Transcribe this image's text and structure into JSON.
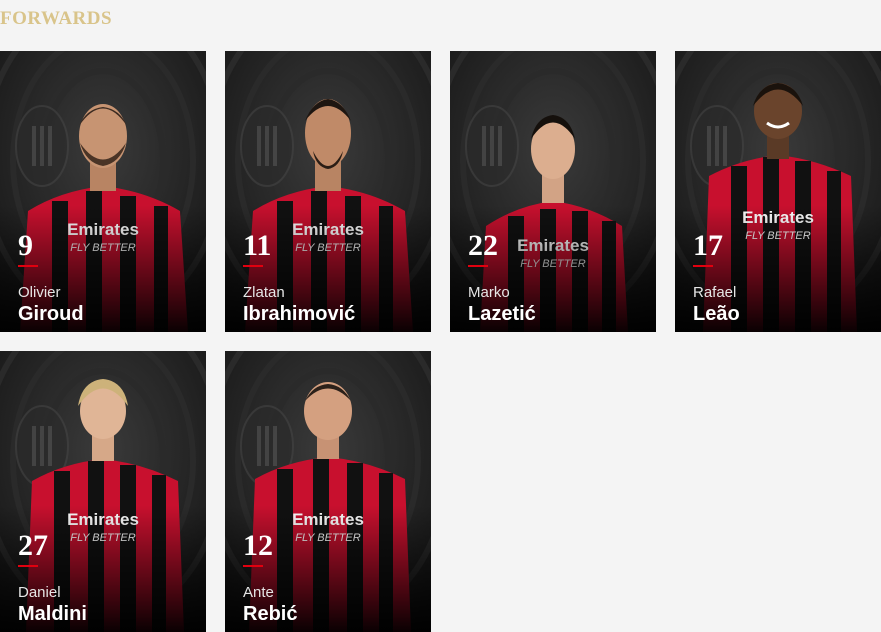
{
  "section": {
    "title": "FORWARDS"
  },
  "colors": {
    "accent_red": "#e1000f",
    "title_gold": "#d9c48a",
    "jersey_red": "#c8102e",
    "jersey_black": "#111111"
  },
  "players": [
    {
      "number": "9",
      "first_name": "Olivier",
      "last_name": "Giroud",
      "jersey_sponsor": "Emirates",
      "jersey_tagline": "FLY BETTER"
    },
    {
      "number": "11",
      "first_name": "Zlatan",
      "last_name": "Ibrahimović",
      "jersey_sponsor": "Emirates",
      "jersey_tagline": "FLY BETTER"
    },
    {
      "number": "22",
      "first_name": "Marko",
      "last_name": "Lazetić",
      "jersey_sponsor": "Emirates",
      "jersey_tagline": "FLY BETTER"
    },
    {
      "number": "17",
      "first_name": "Rafael",
      "last_name": "Leão",
      "jersey_sponsor": "Emirates",
      "jersey_tagline": "FLY BETTER"
    },
    {
      "number": "27",
      "first_name": "Daniel",
      "last_name": "Maldini",
      "jersey_sponsor": "Emirates",
      "jersey_tagline": "FLY BETTER"
    },
    {
      "number": "12",
      "first_name": "Ante",
      "last_name": "Rebić",
      "jersey_sponsor": "Emirates",
      "jersey_tagline": "FLY BETTER"
    }
  ],
  "icons": {
    "club_crest": "ac-milan-crest-icon",
    "kit_brand": "puma-logo-icon"
  }
}
